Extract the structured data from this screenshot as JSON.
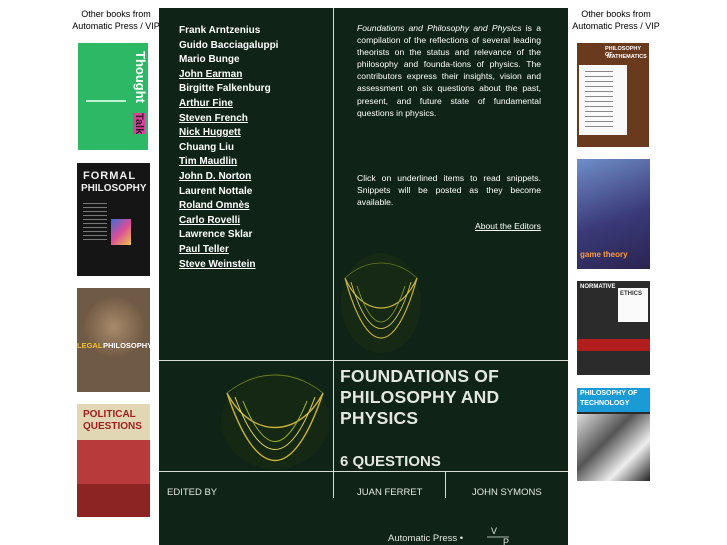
{
  "left_heading": "Other books from Automatic Press / VIP",
  "right_heading": "Other books from Automatic Press / VIP",
  "left_books": [
    {
      "title_a": "Thought",
      "title_b": "Talk"
    },
    {
      "title_a": "FORMAL",
      "title_b": "PHILOSOPHY"
    },
    {
      "title_a": "LEGAL",
      "title_b": "PHILOSOPHY"
    },
    {
      "title_a": "POLITICAL",
      "title_b": "QUESTIONS"
    }
  ],
  "right_books": [
    {
      "title_a": "PHILOSOPHY OF",
      "title_b": "MATHEMATICS"
    },
    {
      "title_a": "game theory",
      "title_b": ""
    },
    {
      "title_a": "NORMATIVE",
      "title_b": "ETHICS"
    },
    {
      "title_a": "PHILOSOPHY OF",
      "title_b": "TECHNOLOGY"
    }
  ],
  "contributors": [
    {
      "name": "Frank Arntzenius",
      "link": false
    },
    {
      "name": "Guido Bacciagaluppi",
      "link": false
    },
    {
      "name": "Mario Bunge",
      "link": false
    },
    {
      "name": "John Earman",
      "link": true
    },
    {
      "name": "Birgitte Falkenburg",
      "link": false
    },
    {
      "name": "Arthur Fine",
      "link": true
    },
    {
      "name": "Steven French",
      "link": true
    },
    {
      "name": "Nick Huggett",
      "link": true
    },
    {
      "name": "Chuang Liu",
      "link": false
    },
    {
      "name": "Tim Maudlin",
      "link": true
    },
    {
      "name": "John D. Norton",
      "link": true
    },
    {
      "name": "Laurent Nottale",
      "link": false
    },
    {
      "name": "Roland Omnès",
      "link": true
    },
    {
      "name": "Carlo Rovelli",
      "link": true
    },
    {
      "name": "Lawrence Sklar",
      "link": false
    },
    {
      "name": "Paul Teller",
      "link": true
    },
    {
      "name": "Steve Weinstein",
      "link": true
    }
  ],
  "description": {
    "book_title": "Foundations and Philosophy and Physics",
    "text": " is a compilation of the reflections of several leading theorists on the status and relevance of the philosophy and founda-tions of physics. The contributors express their insights, vision and assessment on six questions about the past, present, and future state of fundamental questions in physics."
  },
  "instructions": "Click on underlined items to read snippets. Snippets will be posted as they become available.",
  "editors_link": "About the Editors",
  "cover": {
    "title": "FOUNDATIONS OF PHILOSOPHY AND PHYSICS",
    "subtitle": "6 QUESTIONS",
    "edited_by": "EDITED BY",
    "editor_1": "JUAN FERRET",
    "editor_2": "JOHN SYMONS",
    "publisher": "Automatic Press •"
  },
  "colors": {
    "cover_bg": "#0f2416",
    "fractal": "#c8b238",
    "text": "#ffffff"
  }
}
